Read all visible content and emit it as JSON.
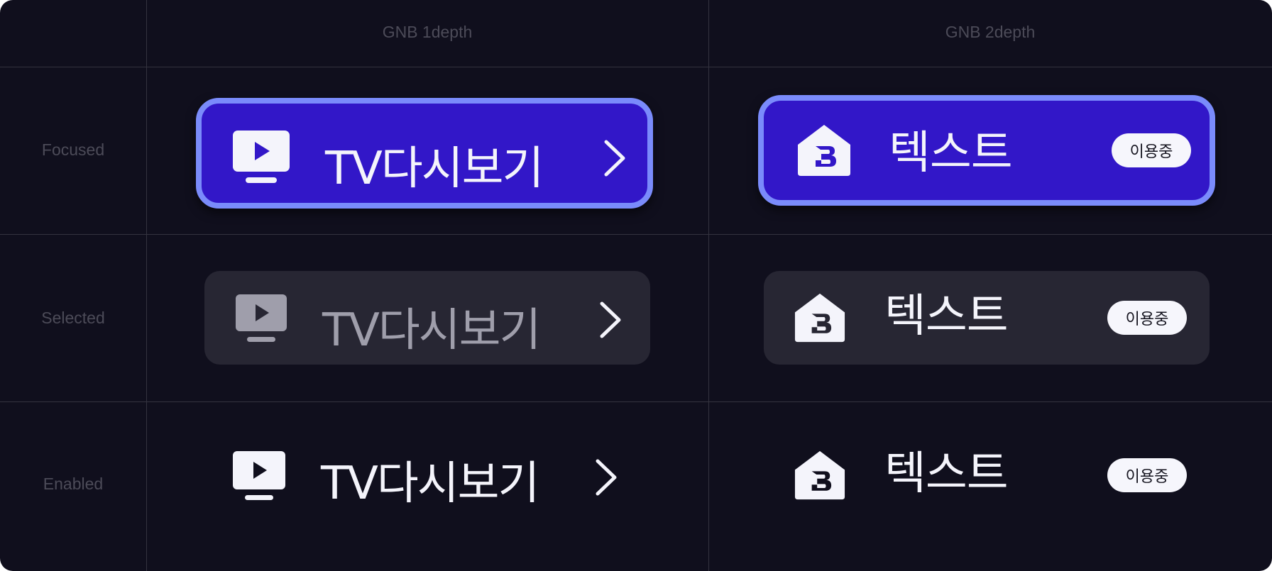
{
  "columns": [
    "GNB 1depth",
    "GNB 2depth"
  ],
  "rows": [
    "Focused",
    "Selected",
    "Enabled"
  ],
  "gnb1": {
    "label": "TV다시보기",
    "icon": "tv-play-icon",
    "trailing_icon": "chevron-right-icon"
  },
  "gnb2": {
    "label": "텍스트",
    "icon": "home-b-icon",
    "badge": "이용중"
  },
  "colors": {
    "background": "#100f1d",
    "focused_fill": "#3217c8",
    "focused_border": "#7a8bfb",
    "selected_fill": "#272633",
    "text": "#f4f4fb",
    "selected_text_muted": "#9f9eab",
    "grid_line": "#34333f",
    "header_text": "#4c4b58"
  }
}
